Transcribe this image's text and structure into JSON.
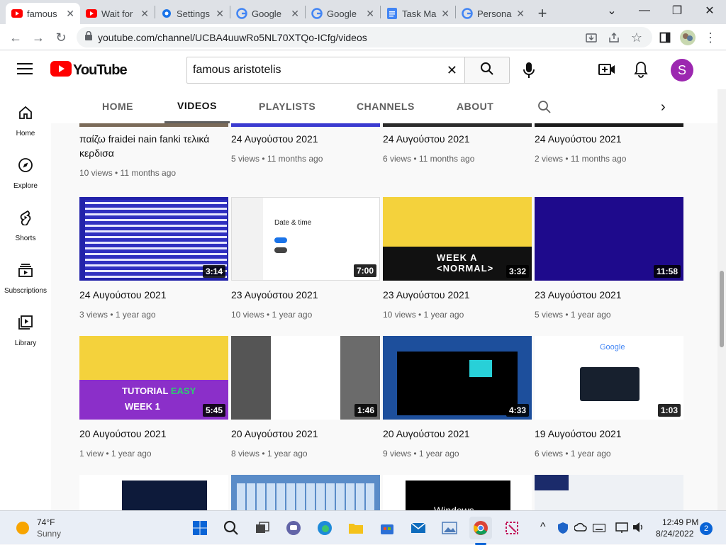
{
  "browser": {
    "tabs": [
      {
        "label": "famous",
        "icon": "youtube-icon",
        "active": true
      },
      {
        "label": "Wait for",
        "icon": "youtube-icon"
      },
      {
        "label": "Settings",
        "icon": "gear-icon"
      },
      {
        "label": "Google",
        "icon": "google-icon"
      },
      {
        "label": "Google",
        "icon": "google-icon"
      },
      {
        "label": "Task Ma",
        "icon": "docs-icon"
      },
      {
        "label": "Persona",
        "icon": "google-icon"
      }
    ],
    "url": "youtube.com/channel/UCBA4uuwRo5NL70XTQo-ICfg/videos"
  },
  "youtube": {
    "logo_text": "YouTube",
    "search_value": "famous aristotelis",
    "avatar_letter": "S",
    "sidebar": [
      {
        "label": "Home",
        "icon": "home-icon"
      },
      {
        "label": "Explore",
        "icon": "compass-icon"
      },
      {
        "label": "Shorts",
        "icon": "shorts-icon"
      },
      {
        "label": "Subscriptions",
        "icon": "subscriptions-icon"
      },
      {
        "label": "Library",
        "icon": "library-icon"
      }
    ],
    "channel_tabs": [
      {
        "label": "HOME"
      },
      {
        "label": "VIDEOS",
        "active": true
      },
      {
        "label": "PLAYLISTS"
      },
      {
        "label": "CHANNELS"
      },
      {
        "label": "ABOUT"
      }
    ],
    "rows": [
      [
        {
          "title": "παίζω fraidei nain fanki τελικά κερδισα",
          "meta": "10 views • 11 months ago"
        },
        {
          "title": "24 Αυγούστου 2021",
          "meta": "5 views • 11 months ago"
        },
        {
          "title": "24 Αυγούστου 2021",
          "meta": "6 views • 11 months ago"
        },
        {
          "title": "24 Αυγούστου 2021",
          "meta": "2 views • 11 months ago"
        }
      ],
      [
        {
          "title": "24 Αυγούστου 2021",
          "meta": "3 views • 1 year ago",
          "duration": "3:14"
        },
        {
          "title": "23 Αυγούστου 2021",
          "meta": "10 views • 1 year ago",
          "duration": "7:00"
        },
        {
          "title": "23 Αυγούστου 2021",
          "meta": "10 views • 1 year ago",
          "duration": "3:32"
        },
        {
          "title": "23 Αυγούστου 2021",
          "meta": "5 views • 1 year ago",
          "duration": "11:58"
        }
      ],
      [
        {
          "title": "20 Αυγούστου 2021",
          "meta": "1 view • 1 year ago",
          "duration": "5:45"
        },
        {
          "title": "20 Αυγούστου 2021",
          "meta": "8 views • 1 year ago",
          "duration": "1:46"
        },
        {
          "title": "20 Αυγούστου 2021",
          "meta": "9 views • 1 year ago",
          "duration": "4:33"
        },
        {
          "title": "19 Αυγούστου 2021",
          "meta": "6 views • 1 year ago",
          "duration": "1:03"
        }
      ]
    ],
    "thumb_texts": {
      "date_time": "Date & time",
      "week_a": "WEEK A",
      "normal": "NORMAL",
      "tutorial": "TUTORIAL",
      "easy": "EASY",
      "week_1": "WEEK 1",
      "google": "Google",
      "windows": "Windows"
    }
  },
  "taskbar": {
    "weather_temp": "74°F",
    "weather_desc": "Sunny",
    "time": "12:49 PM",
    "date": "8/24/2022",
    "notification_count": "2"
  },
  "colors": {
    "youtube_red": "#ff0000",
    "avatar": "#9c27b0"
  }
}
